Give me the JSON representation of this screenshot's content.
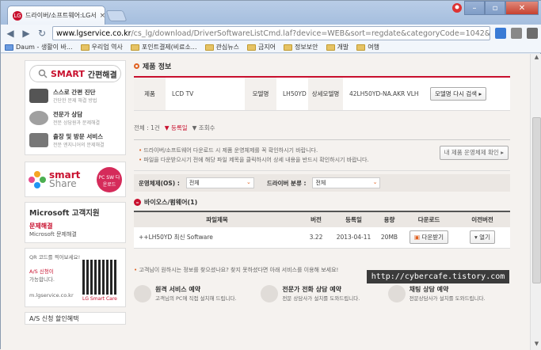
{
  "browser": {
    "tab_title": "드라이버/소프트웨어:LG서",
    "url_host": "www.lgservice.co.kr",
    "url_rest": "/cs_lg/download/DriverSoftwareListCmd.laf?device=WEB&sort=regdate&categoryCode=1042&daepyoMo",
    "bookmarks": [
      "Daum - 생활이 바...",
      "우리업 역사",
      "포인트결제(비료소...",
      "관심뉴스",
      "금지어",
      "정보보안",
      "개발",
      "여행"
    ]
  },
  "sidebar": {
    "smart_brand": "SMART",
    "smart_title": "간편해결",
    "items": [
      {
        "title": "스스로 간편 진단",
        "sub": "간단한 문제 해결 방법"
      },
      {
        "title": "전문가 상담",
        "sub": "전문 상담원과 문제해결"
      },
      {
        "title": "출장 및 방문 서비스",
        "sub": "전문 엔지니어의 문제해결"
      }
    ],
    "share_a": "smart",
    "share_b": "Share",
    "pcsw": "PC SW 다운로드",
    "ms_title": "Microsoft 고객지원",
    "ms_red": "문제해결",
    "ms_sub": "Microsoft 문제해결",
    "qr_l1": "QR 코드를 찍어보세요!",
    "qr_red": "A/S 신청이",
    "qr_l3": "가능합니다.",
    "qr_url": "m.lgservice.co.kr",
    "qr_cap": "LG Smart Care",
    "as_label": "A/S 신청 할인혜택"
  },
  "main": {
    "section_title": "제품 정보",
    "info": {
      "product_label": "제품",
      "product_value": "LCD TV",
      "model_label": "모델명",
      "model_value": "LH50YD",
      "detail_label": "상세모델명",
      "detail_value": "42LH50YD-NA.AKR VLH",
      "research_btn": "모델명 다시 검색"
    },
    "sort": {
      "count": "전체 : 1건",
      "opt1": "등록일",
      "opt2": "조회수"
    },
    "notice": {
      "line1": "드라이버/소프트웨어 다운로드 시 제품 운영체제를 꼭 확인하시기 바랍니다.",
      "line2": "파일을 다운받으시기 전에 해당 파일 제목을 클릭하시어 상세 내용을 반드시 확인하시기 바랍니다.",
      "os_btn": "내 제품 운영체제 확인"
    },
    "filter": {
      "os_label": "운영체제(OS) :",
      "os_value": "전체",
      "type_label": "드라이버 분류 :",
      "type_value": "전체"
    },
    "group_title": "바이오스/펌웨어(1)",
    "table": {
      "headers": [
        "파일제목",
        "버전",
        "등록일",
        "용량",
        "다운로드",
        "이전버전"
      ],
      "rows": [
        {
          "title": "++LH50YD 최신 Software",
          "version": "3.22",
          "date": "2013-04-11",
          "size": "20MB",
          "download": "다운받기",
          "prev": "열기"
        }
      ]
    },
    "service_notice": "고객님이 원하시는 정보를 찾으셨나요? 찾지 못하셨다면 아래 서비스를 이용해 보세요!",
    "services": [
      {
        "title": "원격 서비스 예약",
        "sub": "고객님의 PC에 직접 설치해 드립니다."
      },
      {
        "title": "전문가 전화 상담 예약",
        "sub": "전문 상담사가 설치를 도와드립니다."
      },
      {
        "title": "채팅 상담 예약",
        "sub": "전문상담사가 설치를 도와드립니다."
      }
    ]
  },
  "watermark": "http://cybercafe.tistory.com"
}
